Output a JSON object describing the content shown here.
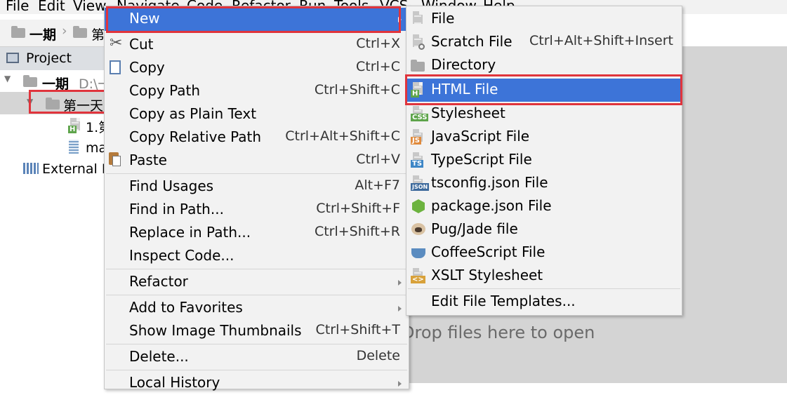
{
  "menubar": {
    "items": [
      "File",
      "Edit",
      "View",
      "Navigate",
      "Code",
      "Refactor",
      "Run",
      "Tools",
      "VCS",
      "Window",
      "Help"
    ]
  },
  "navbar": {
    "crumb1": "一期",
    "crumb2": "第"
  },
  "project_panel": {
    "title": "Project",
    "root_name": "一期",
    "root_path": "D:\\一",
    "selected_folder": "第一天",
    "file1": "1.第",
    "file2": "ma",
    "external": "External L"
  },
  "editor": {
    "hint": "Drop files here to open"
  },
  "context_menu": {
    "new": "New",
    "cut": "Cut",
    "cut_sc": "Ctrl+X",
    "copy": "Copy",
    "copy_sc": "Ctrl+C",
    "copy_path": "Copy Path",
    "copy_path_sc": "Ctrl+Shift+C",
    "copy_plain": "Copy as Plain Text",
    "copy_rel": "Copy Relative Path",
    "copy_rel_sc": "Ctrl+Alt+Shift+C",
    "paste": "Paste",
    "paste_sc": "Ctrl+V",
    "find_usages": "Find Usages",
    "find_usages_sc": "Alt+F7",
    "find_path": "Find in Path...",
    "find_path_sc": "Ctrl+Shift+F",
    "replace_path": "Replace in Path...",
    "replace_path_sc": "Ctrl+Shift+R",
    "inspect": "Inspect Code...",
    "refactor": "Refactor",
    "favorites": "Add to Favorites",
    "thumbnails": "Show Image Thumbnails",
    "thumbnails_sc": "Ctrl+Shift+T",
    "delete": "Delete...",
    "delete_sc": "Delete",
    "local_history": "Local History"
  },
  "new_submenu": {
    "file": "File",
    "scratch": "Scratch File",
    "scratch_sc": "Ctrl+Alt+Shift+Insert",
    "directory": "Directory",
    "html": "HTML File",
    "stylesheet": "Stylesheet",
    "javascript": "JavaScript File",
    "typescript": "TypeScript File",
    "tsconfig": "tsconfig.json File",
    "package": "package.json File",
    "pug": "Pug/Jade file",
    "coffee": "CoffeeScript File",
    "xslt": "XSLT Stylesheet",
    "templates": "Edit File Templates..."
  },
  "colors": {
    "selection": "#3d74d8",
    "highlight_box": "#e0343c",
    "menu_bg": "#f2f2f2"
  }
}
